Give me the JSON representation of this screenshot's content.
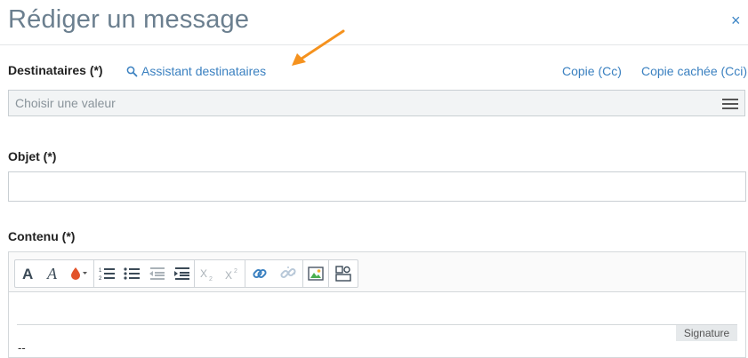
{
  "dialog": {
    "title": "Rédiger un message",
    "close_glyph": "×"
  },
  "recipients": {
    "label": "Destinataires (*)",
    "assistant_link": "Assistant destinataires",
    "cc_link": "Copie (Cc)",
    "bcc_link": "Copie cachée (Cci)",
    "placeholder": "Choisir une valeur"
  },
  "subject": {
    "label": "Objet (*)",
    "value": ""
  },
  "content": {
    "label": "Contenu (*)",
    "signature_label": "Signature",
    "separator_text": "--",
    "toolbar": [
      {
        "group": "text",
        "items": [
          "bold-icon",
          "italic-icon",
          "text-color-icon"
        ]
      },
      {
        "group": "lists",
        "items": [
          "ordered-list-icon",
          "bullet-list-icon",
          "outdent-icon",
          "indent-icon"
        ]
      },
      {
        "group": "script",
        "items": [
          "subscript-icon",
          "superscript-icon"
        ]
      },
      {
        "group": "links",
        "items": [
          "link-icon",
          "unlink-icon"
        ]
      },
      {
        "group": "image",
        "items": [
          "image-icon"
        ]
      },
      {
        "group": "template",
        "items": [
          "template-icon"
        ]
      }
    ]
  },
  "colors": {
    "accent": "#3a80c0",
    "title": "#6b7f8f",
    "arrow": "#f5921e",
    "text_color_icon": "#e2542b"
  }
}
